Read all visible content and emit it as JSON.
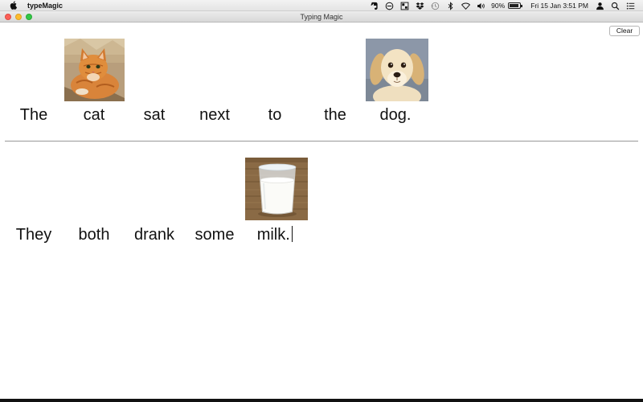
{
  "menubar": {
    "app_name": "typeMagic",
    "battery_percent": "90%",
    "battery_level": 0.9,
    "datetime": "Fri 15 Jan  3:51 PM"
  },
  "window": {
    "title": "Typing Magic"
  },
  "toolbar": {
    "clear_label": "Clear"
  },
  "sentences": [
    {
      "words": [
        "The",
        "cat",
        "sat",
        "next",
        "to",
        "the",
        "dog."
      ],
      "pictures": [
        {
          "word": "cat",
          "icon": "cat-picture"
        },
        {
          "word": "dog.",
          "icon": "dog-picture"
        }
      ]
    },
    {
      "words": [
        "They",
        "both",
        "drank",
        "some",
        "milk."
      ],
      "pictures": [
        {
          "word": "milk.",
          "icon": "milk-picture"
        }
      ]
    }
  ],
  "colors": {
    "close": "#fc5f57",
    "minimize": "#fdbc2e",
    "zoom": "#33c748"
  }
}
